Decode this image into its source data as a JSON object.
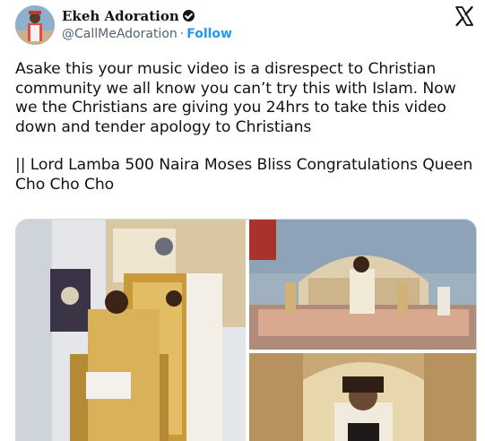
{
  "author": {
    "display_name": "Ekeh Adoration",
    "handle": "@CallMeAdoration",
    "separator": "·",
    "follow_label": "Follow"
  },
  "tweet": {
    "paragraph_1": "Asake this your music video is a disrespect to Christian community we all know you can’t try this with Islam. Now we the Christians are giving you 24hrs to take this video down and tender apology to Christians",
    "paragraph_2": "|| Lord Lamba 500 Naira Moses Bliss Congratulations Queen Cho Cho Cho"
  },
  "icons": {
    "platform_logo": "x-logo-icon",
    "verified": "verified-badge-icon"
  },
  "colors": {
    "accent": "#1d9bf0",
    "text": "#0f1419",
    "muted": "#536471"
  }
}
